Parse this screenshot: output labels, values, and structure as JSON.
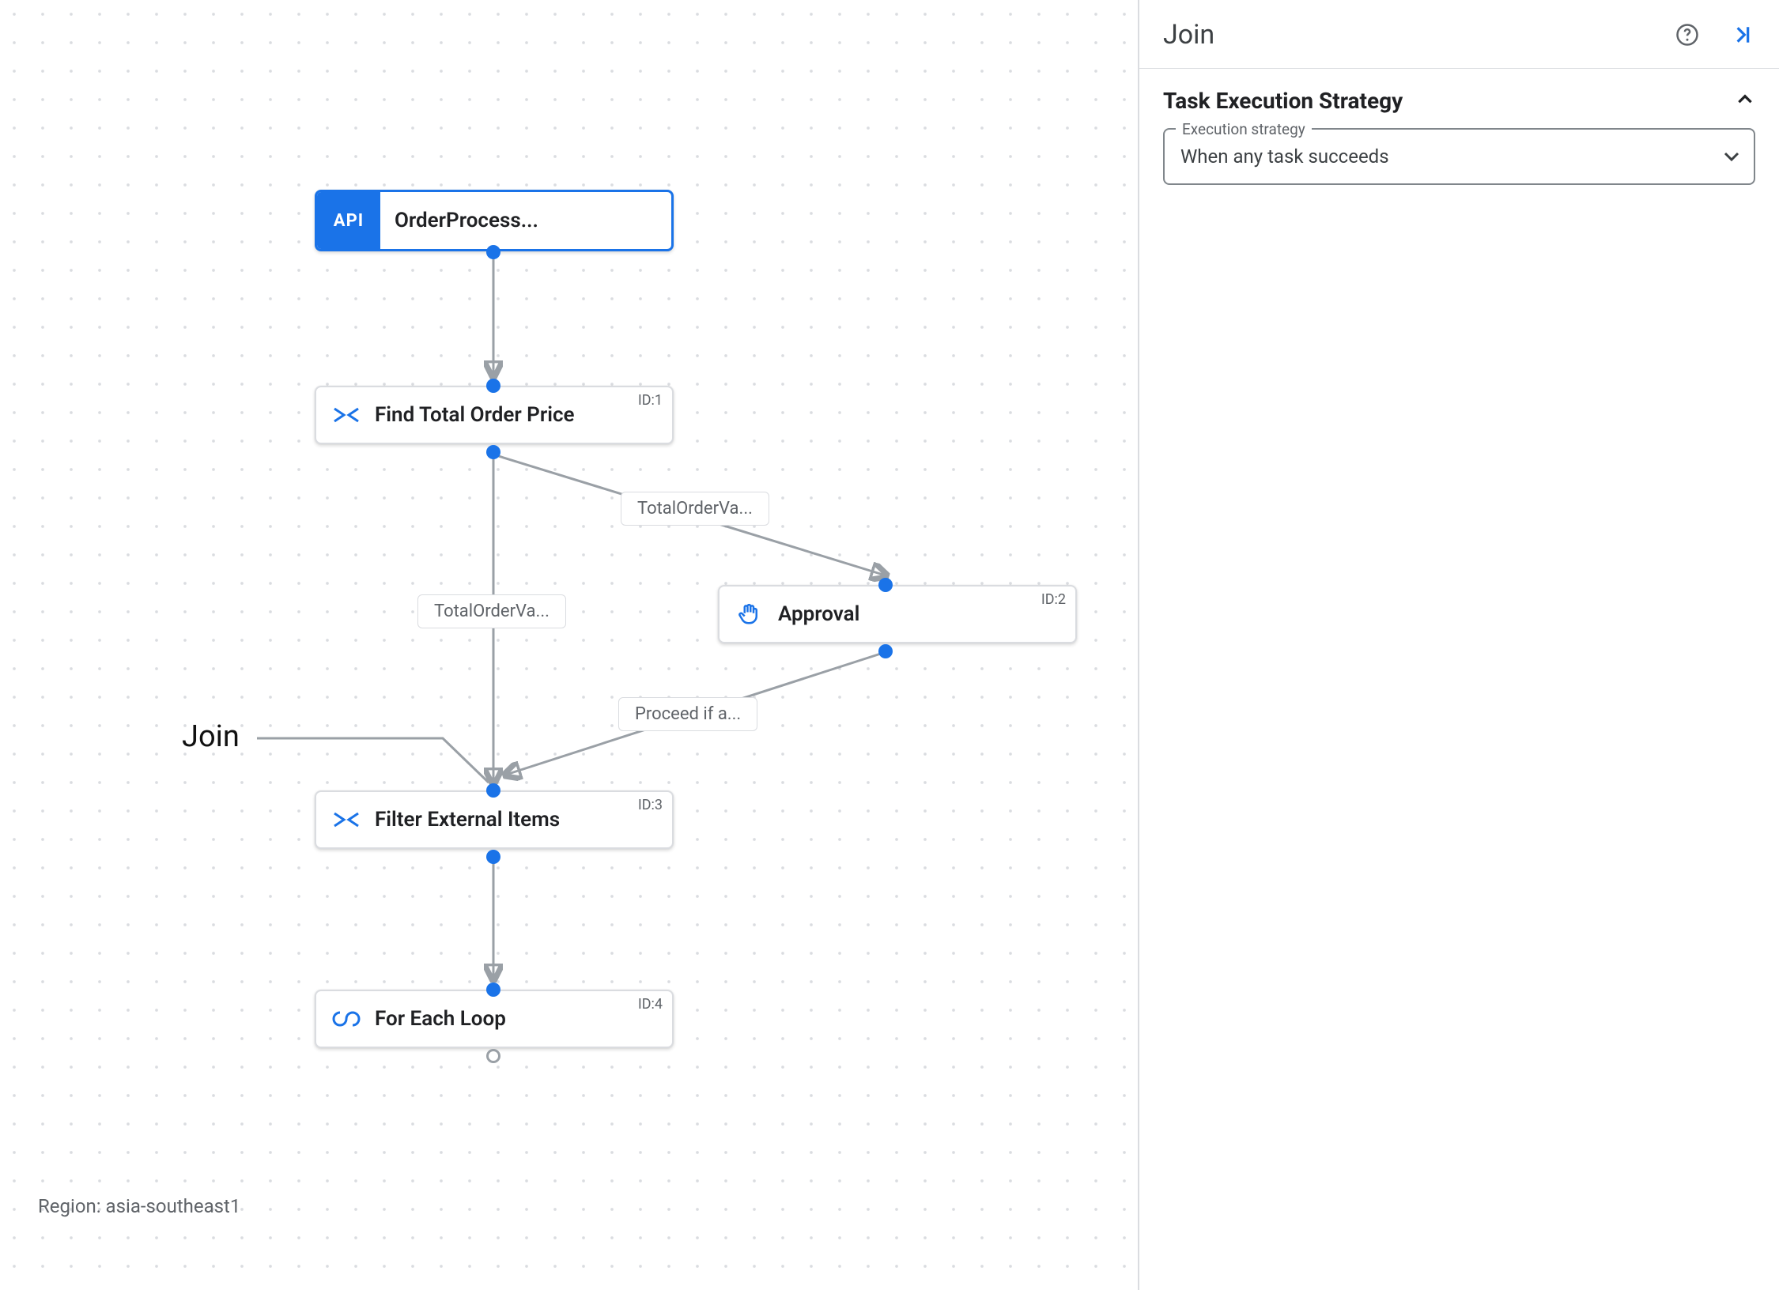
{
  "panel": {
    "title": "Join",
    "help_icon": "help-circle-icon",
    "collapse_icon": "panel-collapse-icon",
    "section": {
      "title": "Task Execution Strategy",
      "expand_icon": "chevron-up-icon",
      "field": {
        "float_label": "Execution strategy",
        "value": "When any task succeeds",
        "caret_icon": "caret-down-icon"
      }
    }
  },
  "canvas": {
    "region_prefix": "Region: ",
    "region": "asia-southeast1",
    "annotation": {
      "label": "Join"
    },
    "nodes": {
      "trigger": {
        "chip": "API",
        "label": "OrderProcess..."
      },
      "n1": {
        "id": "ID:1",
        "label": "Find Total Order Price",
        "icon": "data-map-icon"
      },
      "n2": {
        "id": "ID:2",
        "label": "Approval",
        "icon": "hand-icon"
      },
      "n3": {
        "id": "ID:3",
        "label": "Filter External Items",
        "icon": "data-map-icon"
      },
      "n4": {
        "id": "ID:4",
        "label": "For Each Loop",
        "icon": "loop-icon"
      }
    },
    "edge_labels": {
      "e1": "TotalOrderVa...",
      "e2": "TotalOrderVa...",
      "e3": "Proceed if a..."
    }
  }
}
